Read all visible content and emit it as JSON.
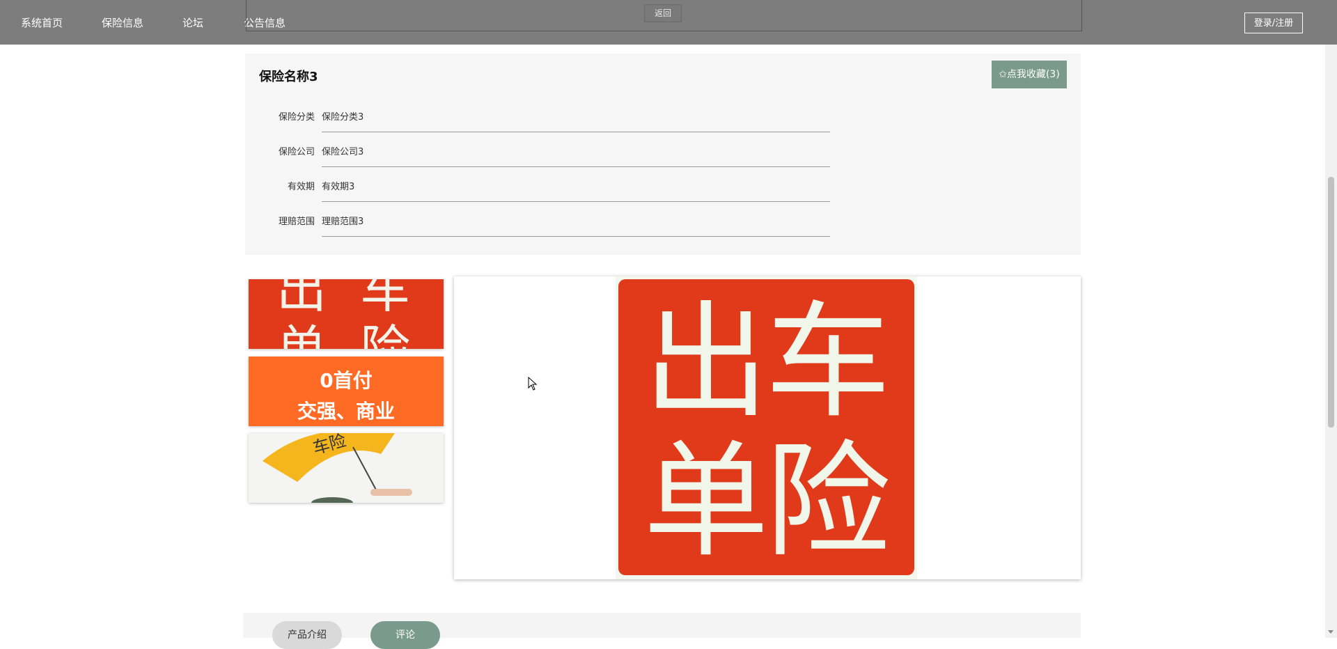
{
  "nav": {
    "items": [
      "系统首页",
      "保险信息",
      "论坛",
      "公告信息"
    ],
    "back_label": "返回",
    "login_label": "登录/注册"
  },
  "product": {
    "title": "保险名称3",
    "favorite_label": "✩点我收藏(3)",
    "fields": [
      {
        "label": "保险分类",
        "value": "保险分类3"
      },
      {
        "label": "保险公司",
        "value": "保险公司3"
      },
      {
        "label": "有效期",
        "value": "有效期3"
      },
      {
        "label": "理赔范围",
        "value": "理赔范围3"
      }
    ]
  },
  "gallery": {
    "thumb1_text": [
      "出",
      "车",
      "单",
      "险"
    ],
    "thumb2_text": [
      "0首付",
      "交强、商业"
    ],
    "thumb3_text": "车险",
    "main_text": [
      "出",
      "车",
      "单",
      "险"
    ]
  },
  "tabs": {
    "intro": "产品介绍",
    "comments": "评论"
  },
  "colors": {
    "nav_bg": "#7d7d7d",
    "accent": "#7b9a8e",
    "stamp_red": "#e13a1b",
    "orange": "#ff6b24"
  }
}
